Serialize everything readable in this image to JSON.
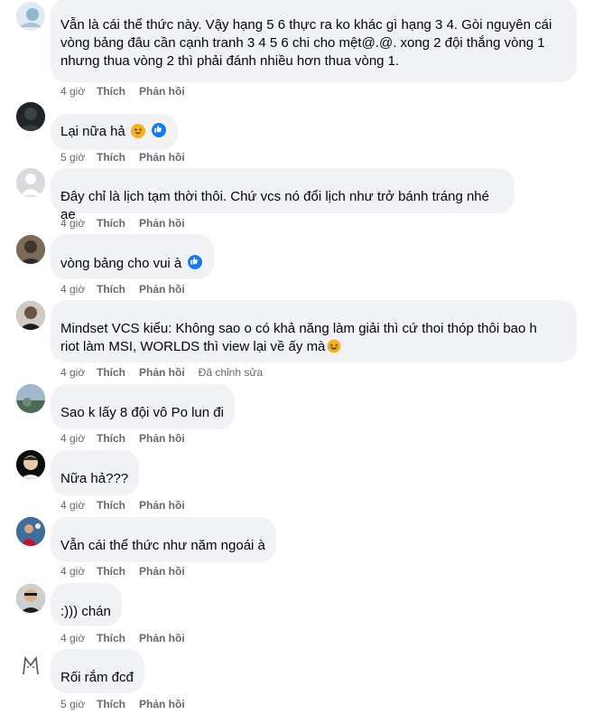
{
  "actions": {
    "like": "Thích",
    "reply": "Phản hồi"
  },
  "comments": [
    {
      "text_line1": "Vẫn là cái thể thức này. Vậy hạng 5 6 thực ra ko khác gì hạng 3 4. Gòi nguyên cái",
      "text_line2": "vòng bảng đâu cần cạnh tranh 3 4 5 6 chi cho mệt@.@. xong 2 đội thắng vòng 1",
      "text_line3": "nhưng thua vòng 2 thì phải đánh nhiều hơn thua vòng 1.",
      "time": "4 giờ"
    },
    {
      "text": "Lại nữa hả",
      "time": "5 giờ"
    },
    {
      "text": "Đây chỉ là lịch tạm thời thôi. Chứ vcs nó đổi lịch như trở bánh tráng nhé ae",
      "time": "4 giờ"
    },
    {
      "text": "vòng bảng cho vui à",
      "time": "4 giờ"
    },
    {
      "text_line1": "Mindset VCS kiểu: Không sao     o có khả năng làm giải thì cứ thoi thóp thôi bao h",
      "text_line2": "riot làm MSI, WORLDS thì view lại về ấy mà",
      "time": "4 giờ",
      "edited": "Đã chỉnh sửa"
    },
    {
      "text": "Sao k lấy 8 đội vô Po lun đi",
      "time": "4 giờ"
    },
    {
      "text": "Nữa hả???",
      "time": "4 giờ"
    },
    {
      "text": "Vẫn cái thể thức như năm ngoái à",
      "time": "4 giờ"
    },
    {
      "text": ":))) chán",
      "time": "4 giờ"
    },
    {
      "text": "Rối rắm đcđ",
      "time": "5 giờ"
    }
  ],
  "colors": {
    "bubble": "#f0f2f5",
    "meta": "#65676b",
    "like_blue": "#1877f2"
  }
}
